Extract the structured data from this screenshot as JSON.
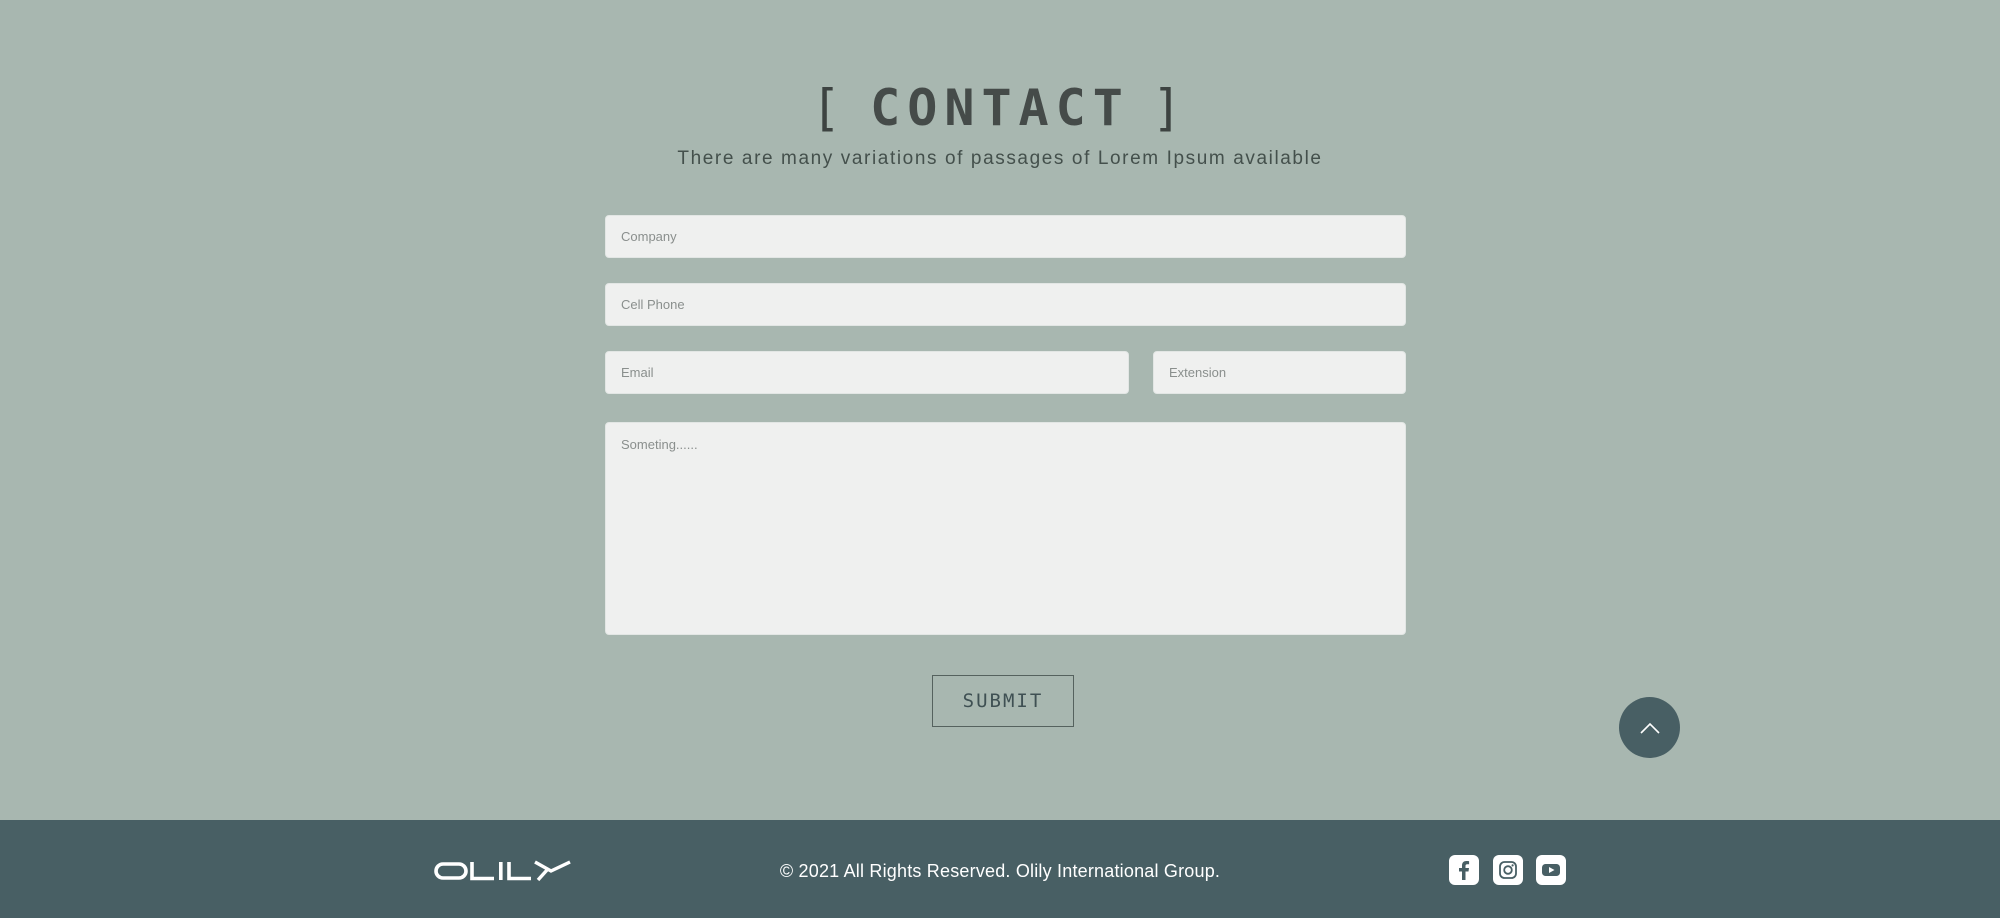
{
  "header": {
    "bracket_open": "[",
    "title": "CONTACT",
    "bracket_close": "]",
    "subtitle": "There are many variations of passages of Lorem Ipsum available"
  },
  "form": {
    "company": {
      "placeholder": "Company",
      "value": ""
    },
    "cell_phone": {
      "placeholder": "Cell Phone",
      "value": ""
    },
    "email": {
      "placeholder": "Email",
      "value": ""
    },
    "extension": {
      "placeholder": "Extension",
      "value": ""
    },
    "message": {
      "placeholder": "Someting......",
      "value": ""
    },
    "submit_label": "SUBMIT"
  },
  "scroll_top": {
    "icon": "chevron-up-icon"
  },
  "footer": {
    "logo_text": "OLILY",
    "copyright": "© 2021 All Rights Reserved. Olily International Group.",
    "social": [
      {
        "name": "facebook",
        "icon": "facebook-icon"
      },
      {
        "name": "instagram",
        "icon": "instagram-icon"
      },
      {
        "name": "youtube",
        "icon": "youtube-icon"
      }
    ]
  },
  "colors": {
    "background": "#a8b7b0",
    "footer": "#485f64",
    "field": "#eff0ef",
    "accent": "#485f64"
  }
}
